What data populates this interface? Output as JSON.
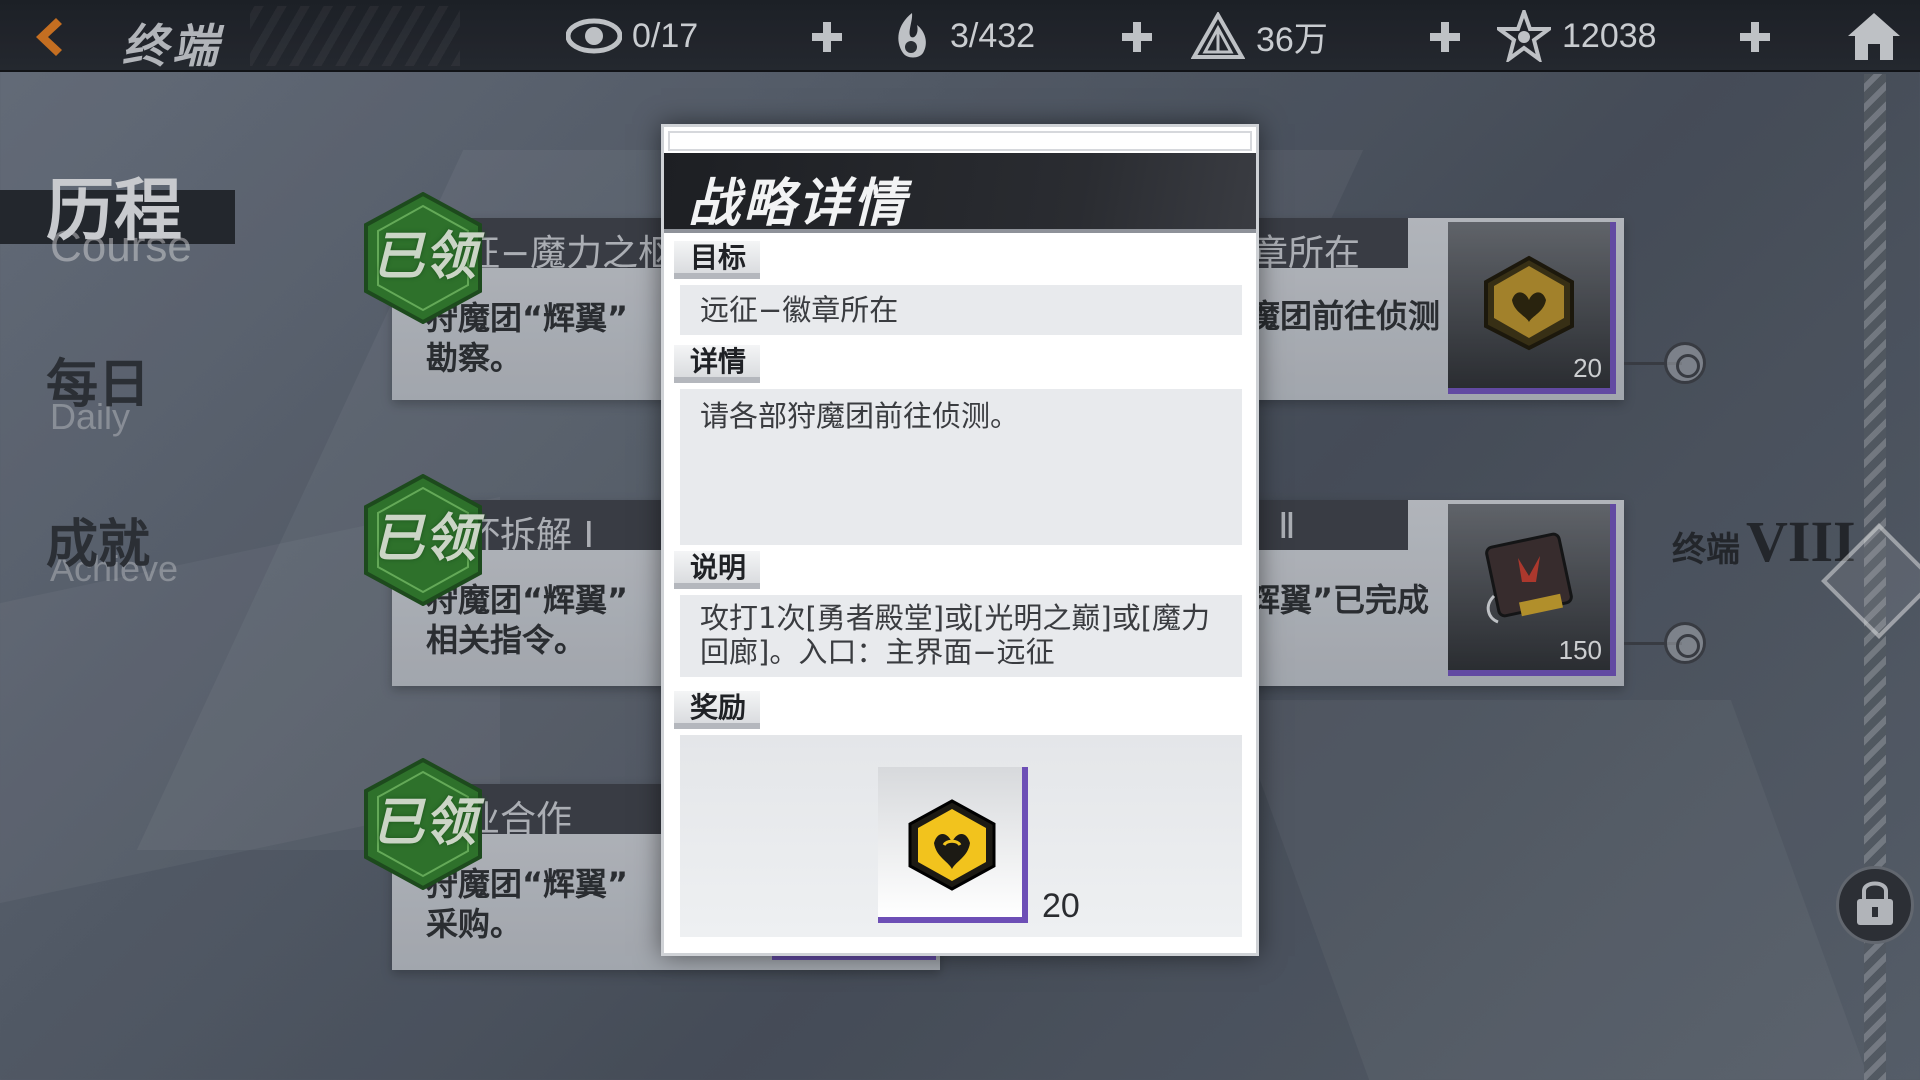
{
  "topbar": {
    "title": "终端",
    "resources": [
      {
        "icon": "eye-icon",
        "value": "0/17"
      },
      {
        "icon": "flame-hand-icon",
        "value": "3/432"
      },
      {
        "icon": "triangle-crystal-icon",
        "value": "36万"
      },
      {
        "icon": "star-icon",
        "value": "12038"
      }
    ]
  },
  "nav": {
    "items": [
      {
        "cn": "历程",
        "en": "Course",
        "active": true
      },
      {
        "cn": "每日",
        "en": "Daily",
        "active": false
      },
      {
        "cn": "成就",
        "en": "Achieve",
        "active": false
      }
    ]
  },
  "tasks": {
    "left": [
      {
        "title": "远征−魔力之枢",
        "desc": "狩魔团“辉翼”\n勘察。",
        "badge": "已领"
      },
      {
        "title": "破坏拆解 Ⅰ",
        "desc": "狩魔团“辉翼”\n相关指令。",
        "badge": "已领"
      },
      {
        "title": "商业合作",
        "desc": "狩魔团“辉翼”\n采购。",
        "badge": "已领"
      }
    ],
    "right": [
      {
        "title": "章所在",
        "desc": "魔团前往侦测",
        "reward_count": "20",
        "reward_icon": "badge-coin-icon"
      },
      {
        "title": "Ⅱ",
        "desc": "辉翼”已完成",
        "reward_count": "150",
        "reward_icon": "chip-card-icon"
      }
    ]
  },
  "side": {
    "terminal_label": "终端",
    "terminal_level": "VIII"
  },
  "modal": {
    "title": "战略详情",
    "goal_label": "目标",
    "goal_text": "远征−徽章所在",
    "detail_label": "详情",
    "detail_text": "请各部狩魔团前往侦测。",
    "note_label": "说明",
    "note_text": "攻打1次[勇者殿堂]或[光明之巅]或[魔力\n回廊]。入口：主界面−远征",
    "reward_label": "奖励",
    "reward_icon": "badge-coin-icon",
    "reward_count": "20"
  },
  "colors": {
    "accent_orange": "#e07a1e",
    "claimed_green": "#2f7d2a",
    "rarity_purple": "#6d4fb6",
    "topbar_bg": "#1b1e24"
  }
}
